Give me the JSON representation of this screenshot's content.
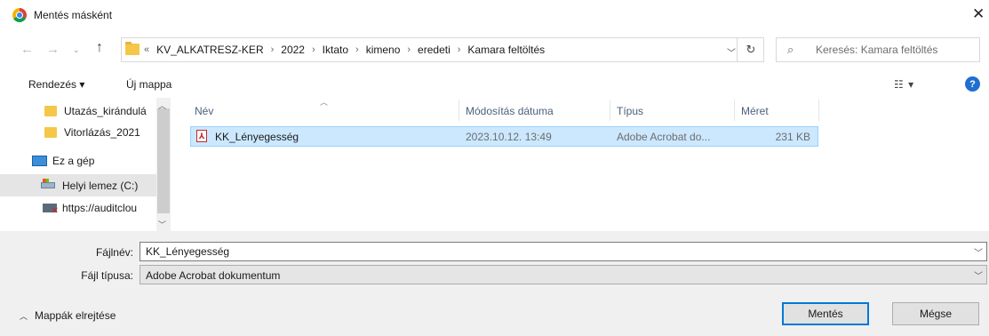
{
  "window": {
    "title": "Mentés másként",
    "close": "✕"
  },
  "address": {
    "crumb_lead": "«",
    "crumbs": [
      "KV_ALKATRESZ-KER",
      "2022",
      "Iktato",
      "kimeno",
      "eredeti",
      "Kamara feltöltés"
    ],
    "separator": "›"
  },
  "search": {
    "placeholder": "Keresés: Kamara feltöltés"
  },
  "toolbar": {
    "organize": "Rendezés ▾",
    "new_folder": "Új mappa",
    "view": "☷ ▾",
    "help": "?"
  },
  "nav": {
    "items": [
      {
        "label": "Utazás_kirándulá",
        "icon": "folder-icon"
      },
      {
        "label": "Vitorlázás_2021",
        "icon": "folder-icon"
      },
      {
        "label": "Ez a gép",
        "icon": "computer-icon"
      },
      {
        "label": "Helyi lemez (C:)",
        "icon": "drive-icon"
      },
      {
        "label": "https://auditclou",
        "icon": "network-drive-icon"
      }
    ]
  },
  "columns": {
    "name": "Név",
    "date": "Módosítás dátuma",
    "type": "Típus",
    "size": "Méret"
  },
  "files": [
    {
      "name": "KK_Lényegesség",
      "date": "2023.10.12. 13:49",
      "type": "Adobe Acrobat do...",
      "size": "231 KB"
    }
  ],
  "form": {
    "filename_label": "Fájlnév:",
    "filename_value": "KK_Lényegesség",
    "filetype_label": "Fájl típusa:",
    "filetype_value": "Adobe Acrobat dokumentum"
  },
  "footer": {
    "hide_folders": "Mappák elrejtése",
    "save": "Mentés",
    "cancel": "Mégse"
  }
}
